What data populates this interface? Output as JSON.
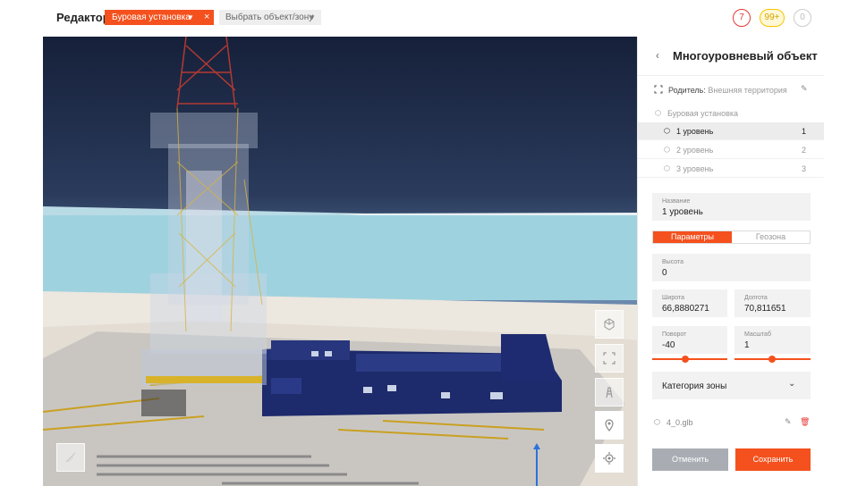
{
  "topbar": {
    "app_title": "Редактор",
    "object_chip": "Буровая установка",
    "object_picker_placeholder": "Выбрать объект/зону",
    "badges": {
      "red": "7",
      "yellow": "99+",
      "grey": "0"
    }
  },
  "panel": {
    "title": "Многоуровневый объект",
    "parent_label": "Родитель:",
    "parent_value": "Внешняя территория",
    "tree_root": "Буровая установка",
    "levels": [
      {
        "label": "1 уровень",
        "num": "1"
      },
      {
        "label": "2 уровень",
        "num": "2"
      },
      {
        "label": "3 уровень",
        "num": "3"
      }
    ],
    "name_caption": "Название",
    "name_value": "1 уровень",
    "tab_params": "Параметры",
    "tab_geozone": "Геозона",
    "height_caption": "Высота",
    "height_value": "0",
    "lat_caption": "Широта",
    "lat_value": "66,8880271",
    "lon_caption": "Долгота",
    "lon_value": "70,811651",
    "rotation_caption": "Поворот",
    "rotation_value": "-40",
    "scale_caption": "Масштаб",
    "scale_value": "1",
    "category_label": "Категория зоны",
    "file_name": "4_0.glb",
    "cancel_label": "Отменить",
    "save_label": "Сохранить"
  },
  "colors": {
    "accent": "#f4511e",
    "badge_red": "#e53935",
    "badge_yellow": "#f9c400",
    "sky_top": "#16203a"
  },
  "icons": [
    "chevron-down-icon",
    "close-icon",
    "chevron-left-icon",
    "expand-icon",
    "pencil-icon",
    "cube-icon",
    "level-icon",
    "trash-icon",
    "ruler-icon",
    "tower-icon",
    "pin-icon",
    "target-icon"
  ]
}
